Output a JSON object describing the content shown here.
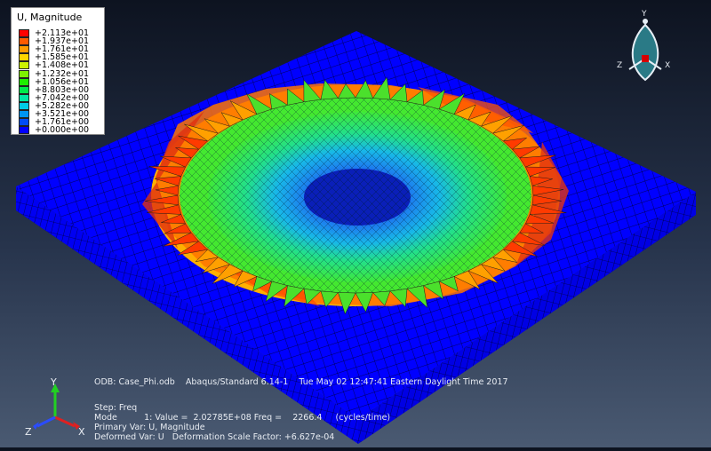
{
  "legend": {
    "title": "U, Magnitude",
    "entries": [
      {
        "label": "+2.113e+01",
        "color": "#ff0000"
      },
      {
        "label": "+1.937e+01",
        "color": "#ff5a00"
      },
      {
        "label": "+1.761e+01",
        "color": "#ff9b00"
      },
      {
        "label": "+1.585e+01",
        "color": "#ffd600"
      },
      {
        "label": "+1.408e+01",
        "color": "#ccf200"
      },
      {
        "label": "+1.232e+01",
        "color": "#7ef000"
      },
      {
        "label": "+1.056e+01",
        "color": "#1fee00"
      },
      {
        "label": "+8.803e+00",
        "color": "#00eb4a"
      },
      {
        "label": "+7.042e+00",
        "color": "#00e8a2"
      },
      {
        "label": "+5.282e+00",
        "color": "#00cce6"
      },
      {
        "label": "+3.521e+00",
        "color": "#0094f2"
      },
      {
        "label": "+1.761e+00",
        "color": "#004cf6"
      },
      {
        "label": "+0.000e+00",
        "color": "#0000ff"
      }
    ]
  },
  "info": {
    "line1": "ODB: Case_Phi.odb    Abaqus/Standard 6.14-1    Tue May 02 12:47:41 Eastern Daylight Time 2017",
    "line2": "Step: Freq",
    "line3": "Mode          1: Value =  2.02785E+08 Freq =    2266.4     (cycles/time)",
    "line4": "Primary Var: U, Magnitude",
    "line5": "Deformed Var: U   Deformation Scale Factor: +6.627e-04"
  },
  "triad": {
    "x": "X",
    "y": "Y",
    "z": "Z"
  },
  "view_cube": {
    "x": "X",
    "y": "Y",
    "z": "Z"
  },
  "colors": {
    "plate": "#0000ff",
    "mesh_line": "#000000"
  }
}
